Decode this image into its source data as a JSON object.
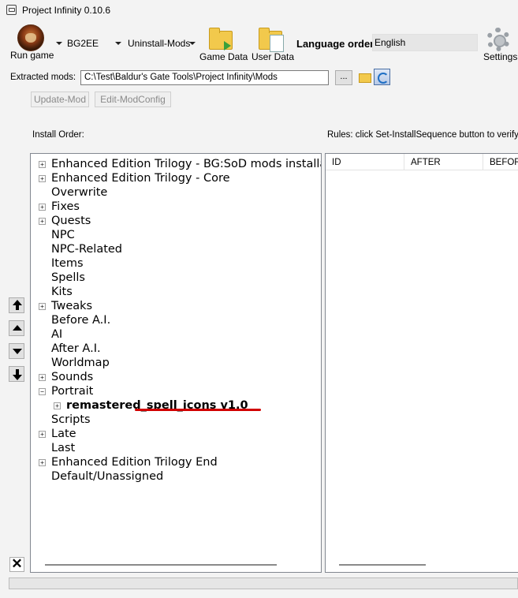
{
  "window": {
    "title": "Project Infinity 0.10.6"
  },
  "toolbar": {
    "run_game_label": "Run game",
    "game_select": "BG2EE",
    "mode_select": "Uninstall-Mods",
    "game_data_label": "Game Data",
    "user_data_label": "User Data",
    "language_order_label": "Language order:",
    "language_value": "English",
    "settings_label": "Settings"
  },
  "extracted": {
    "label": "Extracted mods:",
    "path": "C:\\Test\\Baldur's Gate Tools\\Project Infinity\\Mods",
    "browse_label": "..."
  },
  "actions": {
    "update_mod": "Update-Mod",
    "edit_modconfig": "Edit-ModConfig"
  },
  "install_order": {
    "label": "Install Order:",
    "items": [
      {
        "label": "Enhanced Edition Trilogy - BG:SoD mods installa",
        "expander": "+"
      },
      {
        "label": "Enhanced Edition Trilogy - Core",
        "expander": "+"
      },
      {
        "label": "Overwrite",
        "expander": ""
      },
      {
        "label": "Fixes",
        "expander": "+"
      },
      {
        "label": "Quests",
        "expander": "+"
      },
      {
        "label": "NPC",
        "expander": ""
      },
      {
        "label": "NPC-Related",
        "expander": ""
      },
      {
        "label": "Items",
        "expander": ""
      },
      {
        "label": "Spells",
        "expander": ""
      },
      {
        "label": "Kits",
        "expander": ""
      },
      {
        "label": "Tweaks",
        "expander": "+"
      },
      {
        "label": "Before A.I.",
        "expander": ""
      },
      {
        "label": "AI",
        "expander": ""
      },
      {
        "label": "After A.I.",
        "expander": ""
      },
      {
        "label": "Worldmap",
        "expander": ""
      },
      {
        "label": "Sounds",
        "expander": "+"
      },
      {
        "label": "Portrait",
        "expander": "−"
      },
      {
        "label": "remastered_spell_icons v1.0",
        "expander": "+",
        "child": true,
        "bold": true
      },
      {
        "label": "Scripts",
        "expander": ""
      },
      {
        "label": "Late",
        "expander": "+"
      },
      {
        "label": "Last",
        "expander": ""
      },
      {
        "label": "Enhanced Edition Trilogy End",
        "expander": "+"
      },
      {
        "label": "Default/Unassigned",
        "expander": ""
      }
    ]
  },
  "rules": {
    "label": "Rules: click Set-InstallSequence button to verify",
    "columns": [
      "ID",
      "AFTER",
      "BEFOR"
    ]
  },
  "side_buttons": {
    "close_glyph": "✕"
  },
  "colors": {
    "highlight_underline": "#d10000",
    "refresh_accent": "#1f6fc4"
  }
}
